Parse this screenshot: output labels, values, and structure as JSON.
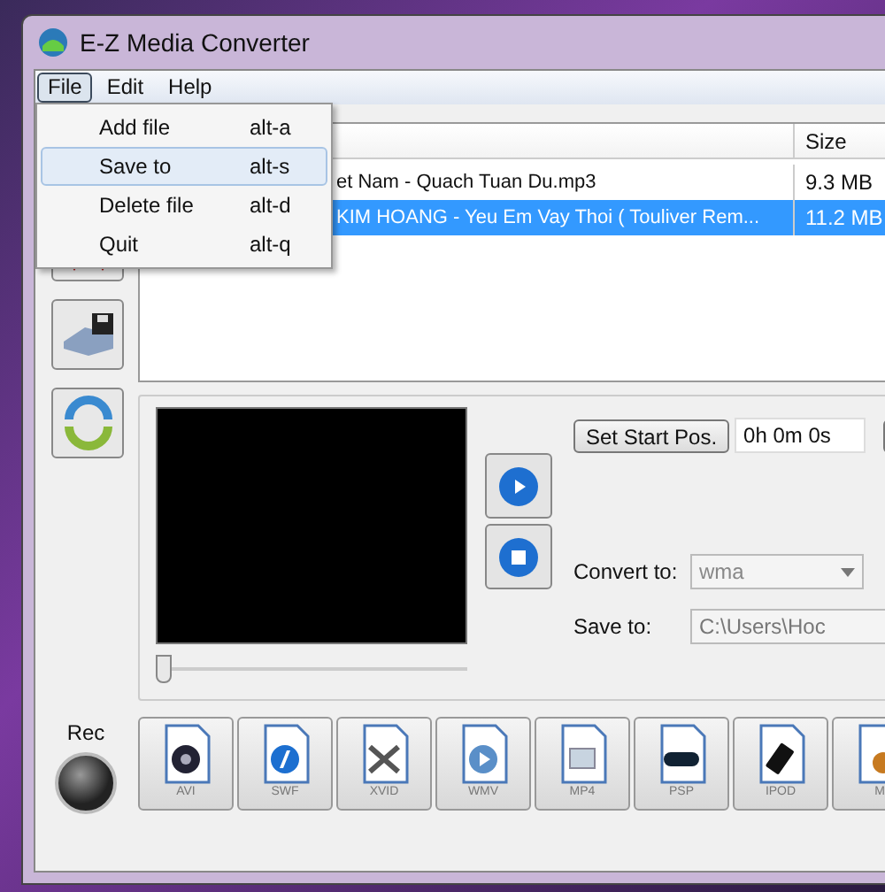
{
  "window": {
    "title": "E-Z Media Converter"
  },
  "menu": [
    {
      "label": "File",
      "selected": true
    },
    {
      "label": "Edit",
      "selected": false
    },
    {
      "label": "Help",
      "selected": false
    }
  ],
  "file_menu": [
    {
      "label": "Add file",
      "shortcut": "alt-a",
      "selected": false
    },
    {
      "label": "Save to",
      "shortcut": "alt-s",
      "selected": true
    },
    {
      "label": "Delete file",
      "shortcut": "alt-d",
      "selected": false
    },
    {
      "label": "Quit",
      "shortcut": "alt-q",
      "selected": false
    }
  ],
  "file_list": {
    "columns": [
      "Size"
    ],
    "rows": [
      {
        "name": "et Nam - Quach Tuan Du.mp3",
        "size": "9.3 MB",
        "selected": false
      },
      {
        "name": "KIM HOANG - Yeu Em Vay Thoi ( Touliver Rem...",
        "size": "11.2 MB",
        "selected": true
      }
    ]
  },
  "player": {
    "level": 0,
    "set_start_button": "Set Start Pos.",
    "start_pos": "0h 0m 0s"
  },
  "convert_to": {
    "label": "Convert to:",
    "value": "wma"
  },
  "save_to": {
    "label": "Save to:",
    "value": "C:\\Users\\Hoc"
  },
  "rec": {
    "label": "Rec"
  },
  "formats": [
    {
      "label": "AVI",
      "kind": "film"
    },
    {
      "label": "SWF",
      "kind": "flash"
    },
    {
      "label": "XVID",
      "kind": "cross"
    },
    {
      "label": "WMV",
      "kind": "play"
    },
    {
      "label": "MP4",
      "kind": "box"
    },
    {
      "label": "PSP",
      "kind": "handheld"
    },
    {
      "label": "IPOD",
      "kind": "player"
    },
    {
      "label": "M",
      "kind": "music"
    }
  ]
}
